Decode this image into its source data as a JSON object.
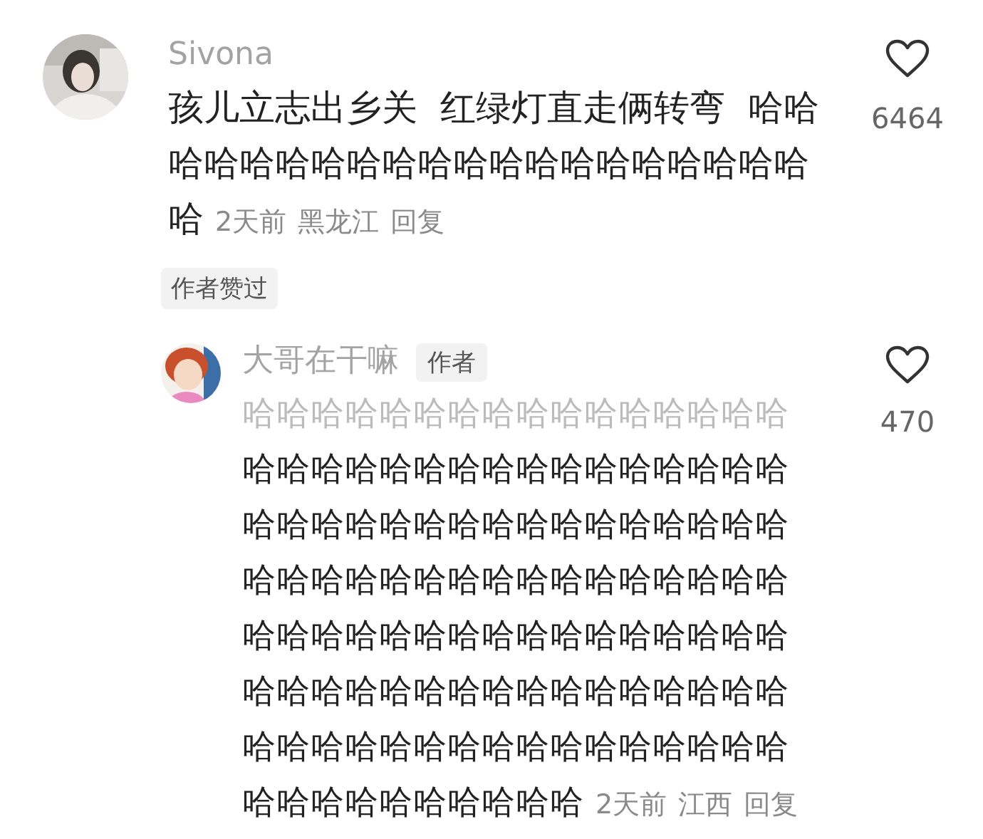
{
  "comment": {
    "name": "Sivona",
    "lines": [
      "孩儿立志出乡关  红绿灯直走俩转弯  哈哈",
      "哈哈哈哈哈哈哈哈哈哈哈哈哈哈哈哈哈哈",
      "哈"
    ],
    "time": "2天前",
    "location": "黑龙江",
    "reply": "回复",
    "likes": "6464",
    "liked_by_author": "作者赞过"
  },
  "reply": {
    "name": "大哥在干嘛",
    "badge": "作者",
    "lines": [
      "哈哈哈哈哈哈哈哈哈哈哈哈哈哈哈哈",
      "哈哈哈哈哈哈哈哈哈哈哈哈哈哈哈哈",
      "哈哈哈哈哈哈哈哈哈哈哈哈哈哈哈哈",
      "哈哈哈哈哈哈哈哈哈哈哈哈哈哈哈哈",
      "哈哈哈哈哈哈哈哈哈哈哈哈哈哈哈哈",
      "哈哈哈哈哈哈哈哈哈哈哈哈哈哈哈哈",
      "哈哈哈哈哈哈哈哈哈哈哈哈哈哈哈哈",
      "哈哈哈哈哈哈哈哈哈哈"
    ],
    "time": "2天前",
    "location": "江西",
    "reply": "回复",
    "likes": "470"
  }
}
